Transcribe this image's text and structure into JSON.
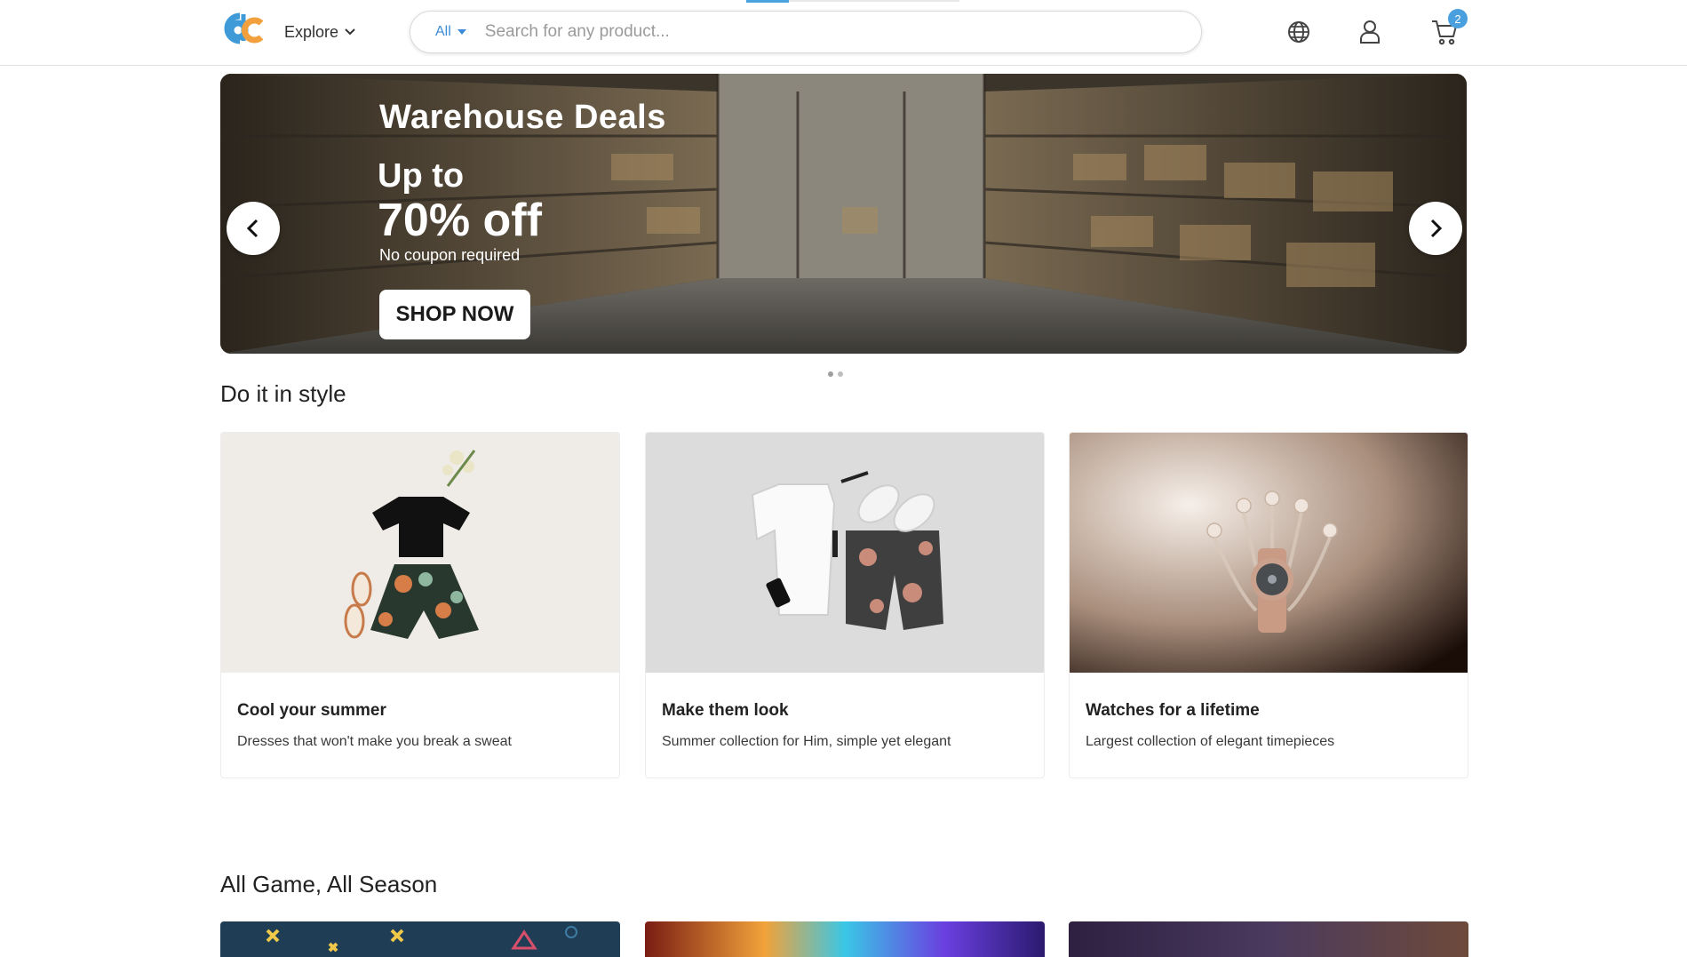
{
  "header": {
    "explore_label": "Explore",
    "search": {
      "category": "All",
      "placeholder": "Search for any product..."
    },
    "cart_count": "2",
    "icons": [
      "globe-icon",
      "user-icon",
      "cart-icon"
    ],
    "accent_color": "#4aa0de"
  },
  "banner": {
    "title": "Warehouse Deals",
    "upto": "Up to",
    "discount": "70% off",
    "note": "No coupon required",
    "cta": "SHOP NOW",
    "slide_count": 2,
    "active_slide": 1
  },
  "style_section": {
    "title": "Do it in style",
    "cards": [
      {
        "title": "Cool your summer",
        "subtitle": "Dresses that won't make you break a sweat"
      },
      {
        "title": "Make them look",
        "subtitle": "Summer collection for Him, simple yet elegant"
      },
      {
        "title": "Watches for a lifetime",
        "subtitle": "Largest collection of elegant timepieces"
      }
    ]
  },
  "game_section": {
    "title": "All Game, All Season"
  }
}
